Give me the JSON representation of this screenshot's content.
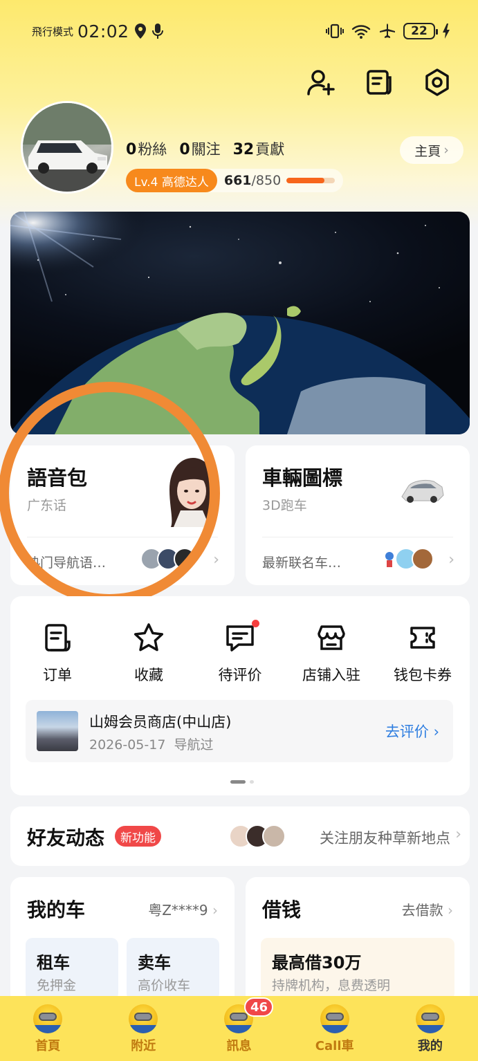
{
  "status_bar": {
    "mode": "飛行模式",
    "time": "02:02",
    "battery": "22"
  },
  "profile": {
    "followers_count": "0",
    "followers_label": "粉絲",
    "following_count": "0",
    "following_label": "關注",
    "contribution_count": "32",
    "contribution_label": "貢獻",
    "home_button": "主頁",
    "level_tag": "Lv.4 高德达人",
    "level_points": "661",
    "level_total": "/850",
    "level_progress": 0.78
  },
  "voice_card": {
    "title": "語音包",
    "subtitle": "广东话",
    "footer": "热门导航语…"
  },
  "vehicle_card": {
    "title": "車輛圖標",
    "subtitle": "3D跑车",
    "footer": "最新联名车…"
  },
  "functions": [
    {
      "label": "订单",
      "icon": "order-icon"
    },
    {
      "label": "收藏",
      "icon": "star-icon"
    },
    {
      "label": "待评价",
      "icon": "comment-icon"
    },
    {
      "label": "店铺入驻",
      "icon": "store-icon"
    },
    {
      "label": "钱包卡券",
      "icon": "wallet-icon"
    }
  ],
  "review": {
    "store_name": "山姆会员商店(中山店)",
    "date": "2026-05-17",
    "status": "导航过",
    "action": "去评价"
  },
  "friends": {
    "title": "好友动态",
    "badge": "新功能",
    "link": "关注朋友种草新地点"
  },
  "car": {
    "title": "我的车",
    "plate": "粤Z****9",
    "tiles": [
      {
        "title": "租车",
        "subtitle": "免押金"
      },
      {
        "title": "卖车",
        "subtitle": "高价收车"
      }
    ]
  },
  "loan": {
    "title": "借钱",
    "action": "去借款",
    "tile_title": "最高借30万",
    "tile_subtitle": "持牌机构，息费透明"
  },
  "bottom_nav": [
    {
      "label": "首頁"
    },
    {
      "label": "附近"
    },
    {
      "label": "訊息",
      "badge": "46"
    },
    {
      "label": "Call車"
    },
    {
      "label": "我的"
    }
  ],
  "colors": {
    "accent_orange": "#f7891c",
    "nav_yellow": "#fde35a",
    "badge_red": "#f04848",
    "link_blue": "#2f7ee0",
    "highlight_circle": "#f08a35"
  }
}
